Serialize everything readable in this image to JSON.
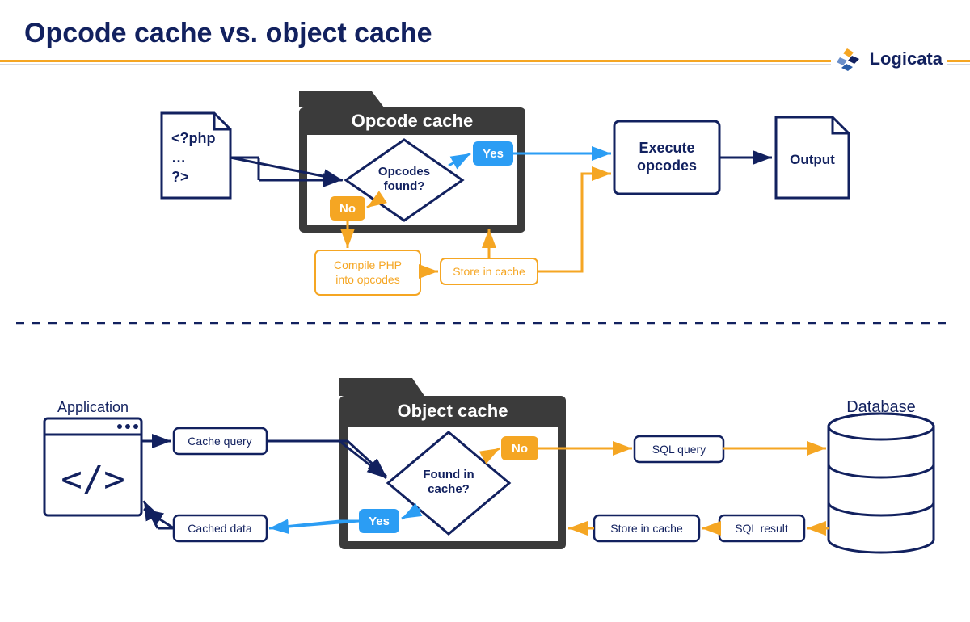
{
  "title": "Opcode cache vs. object cache",
  "brand": "Logicata",
  "colors": {
    "navy": "#12215f",
    "orange": "#f5a623",
    "blue": "#2b9df4",
    "dark": "#3b3b3b",
    "white": "#ffffff"
  },
  "opcode": {
    "fileText": "<?php\n…\n?>",
    "boxTitle": "Opcode cache",
    "decision": "Opcodes found?",
    "yes": "Yes",
    "no": "No",
    "compile": "Compile PHP into opcodes",
    "store": "Store in cache",
    "exec": "Execute opcodes",
    "output": "Output"
  },
  "object": {
    "appLabel": "Application",
    "cacheQuery": "Cache query",
    "boxTitle": "Object cache",
    "decision": "Found in cache?",
    "yes": "Yes",
    "no": "No",
    "cachedData": "Cached data",
    "sqlQuery": "SQL query",
    "sqlResult": "SQL result",
    "store": "Store in cache",
    "dbLabel": "Database"
  }
}
